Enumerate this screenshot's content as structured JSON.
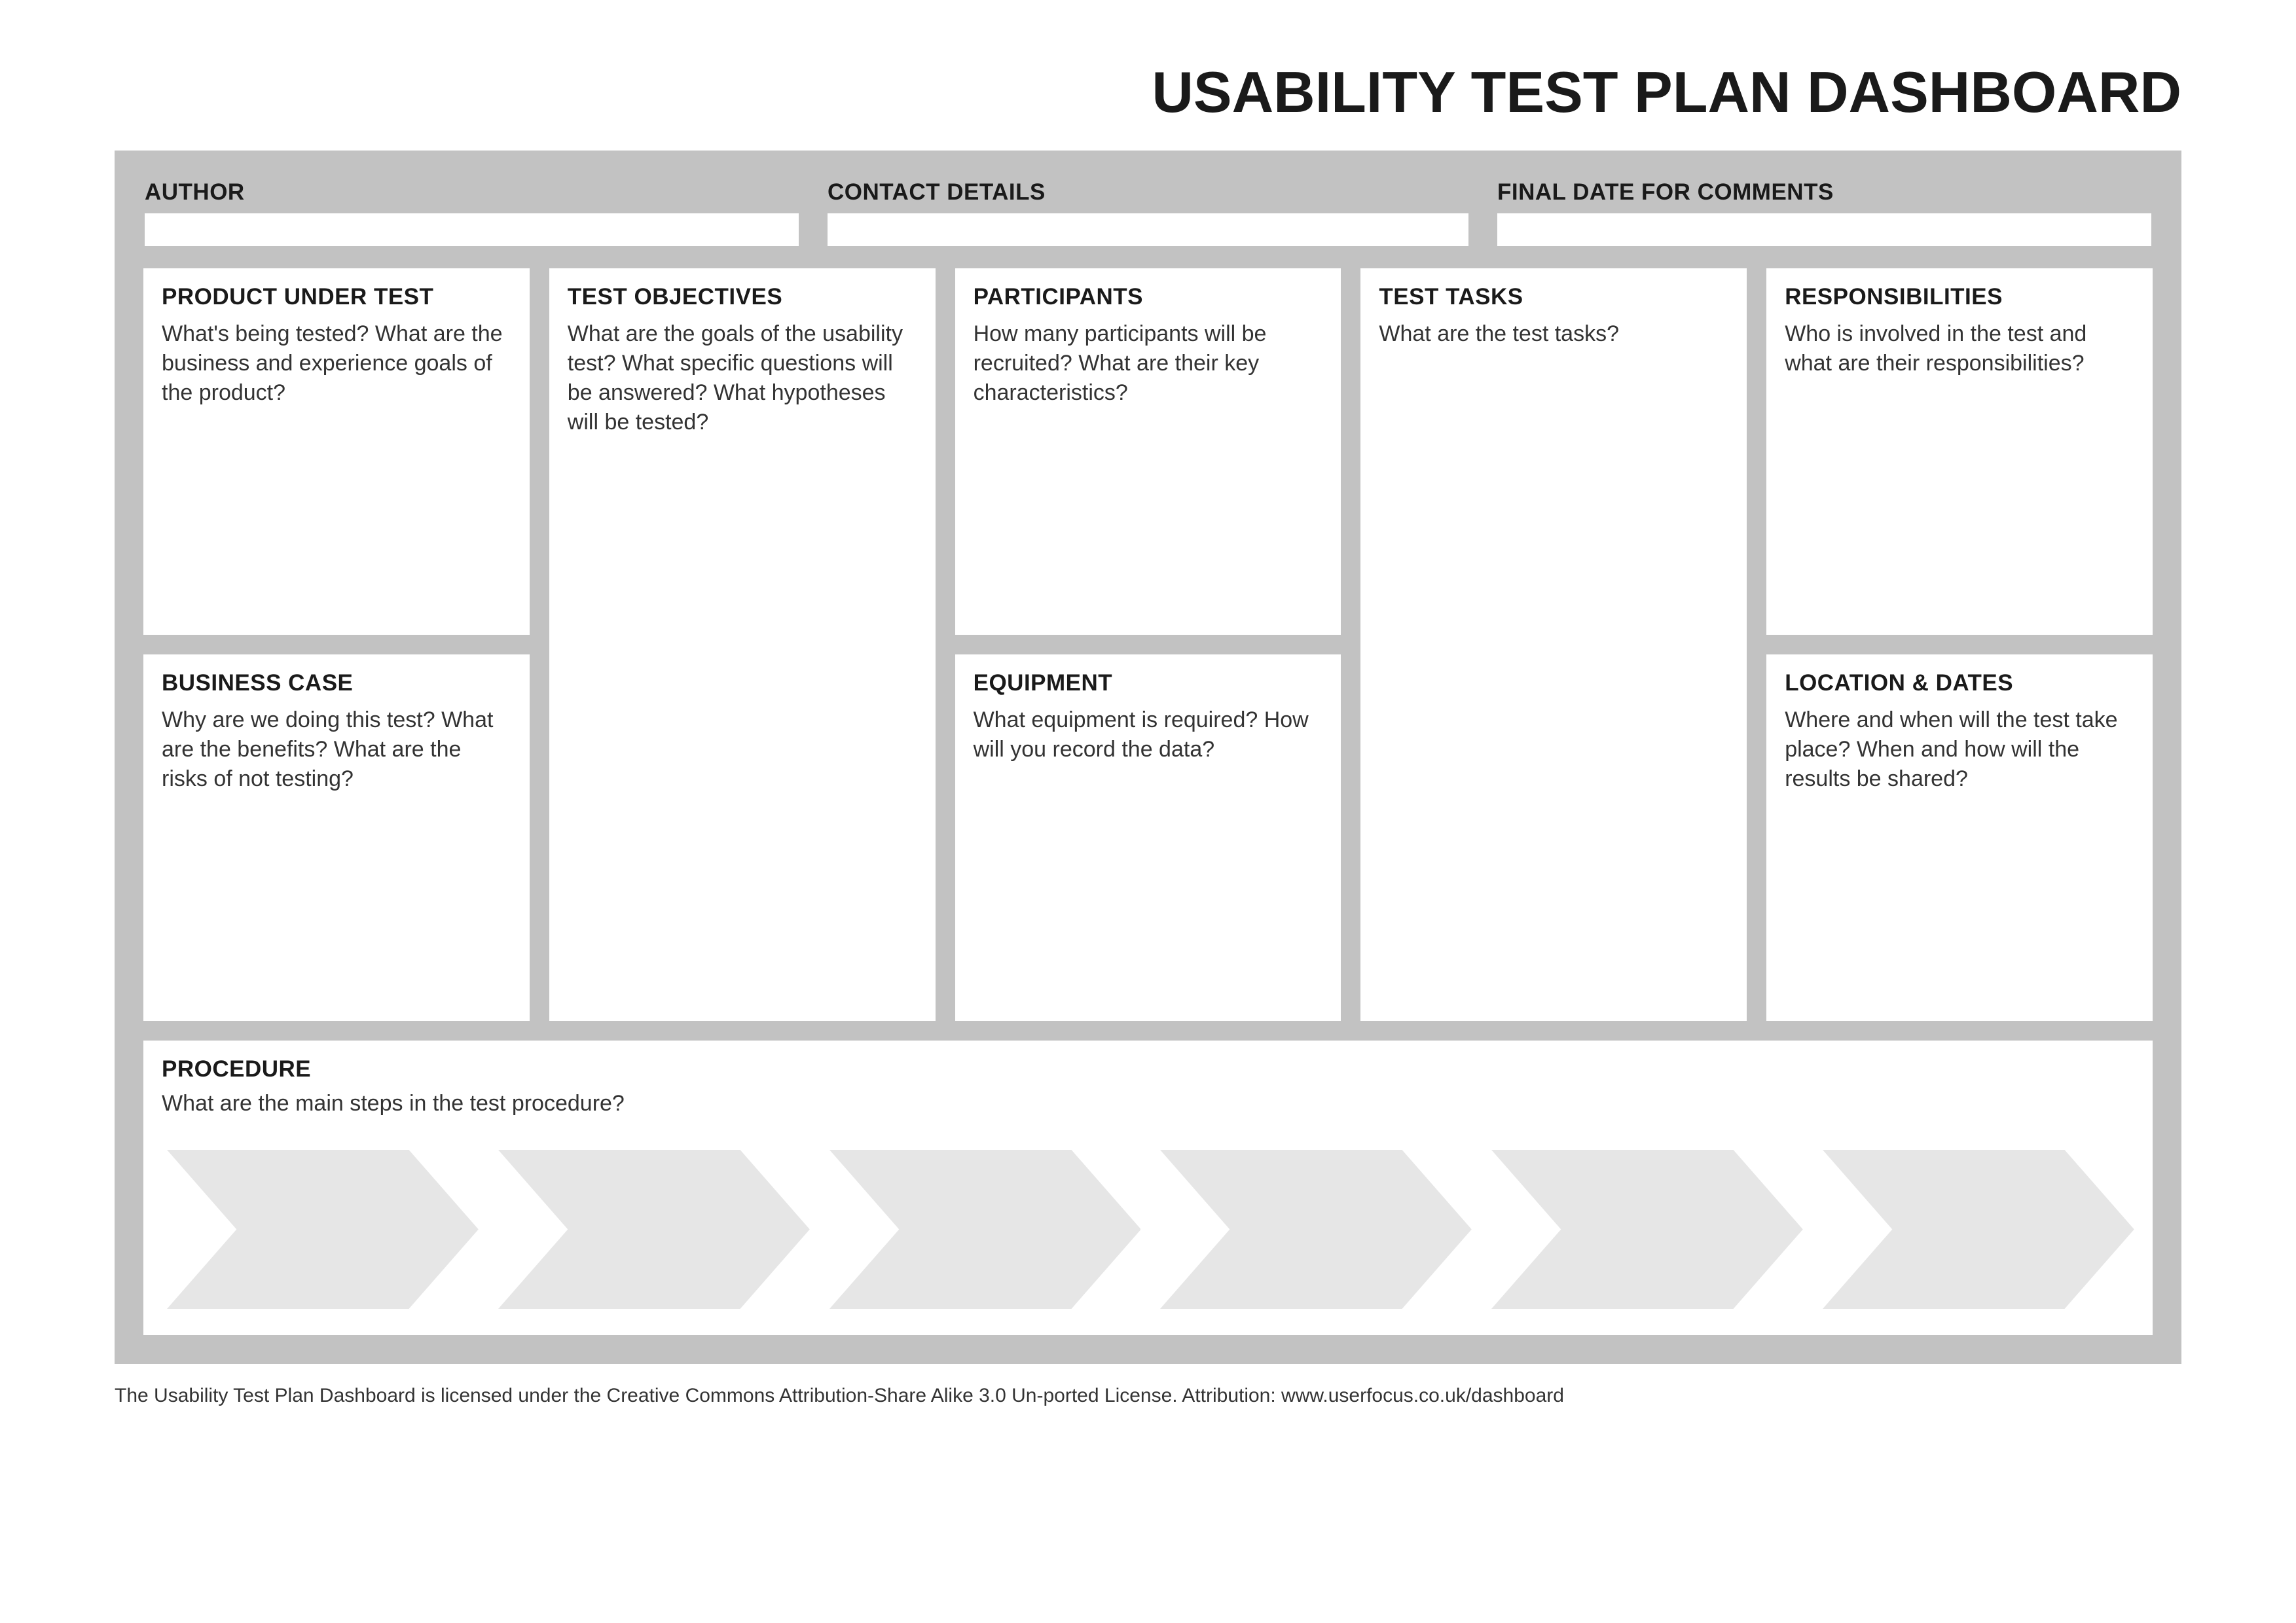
{
  "title": "USABILITY TEST PLAN DASHBOARD",
  "meta": {
    "author_label": "AUTHOR",
    "contact_label": "CONTACT DETAILS",
    "final_date_label": "FINAL DATE FOR COMMENTS",
    "author_value": "",
    "contact_value": "",
    "final_date_value": ""
  },
  "cards": {
    "product_under_test": {
      "title": "PRODUCT UNDER TEST",
      "text": "What's being tested? What are the business and experience goals of the product?"
    },
    "test_objectives": {
      "title": "TEST OBJECTIVES",
      "text": "What are the goals of the usability test? What specific questions will be answered? What hypotheses will be tested?"
    },
    "participants": {
      "title": "PARTICIPANTS",
      "text": "How many participants will be recruited? What are their key characteristics?"
    },
    "test_tasks": {
      "title": "TEST TASKS",
      "text": "What are the test tasks?"
    },
    "responsibilities": {
      "title": "RESPONSIBILITIES",
      "text": "Who is involved in the test and what are their responsibilities?"
    },
    "business_case": {
      "title": "BUSINESS CASE",
      "text": "Why are we doing this test? What are the benefits? What are the risks of not testing?"
    },
    "equipment": {
      "title": "EQUIPMENT",
      "text": "What equipment is required? How will you record the data?"
    },
    "location_dates": {
      "title": "LOCATION & DATES",
      "text": "Where and when will the test take place? When and how will the results be shared?"
    },
    "procedure": {
      "title": "PROCEDURE",
      "text": "What are the main steps in the test procedure?"
    }
  },
  "colors": {
    "canvas_bg": "#c2c2c2",
    "card_bg": "#ffffff",
    "chevron_fill": "#e6e6e6"
  },
  "procedure_steps_count": 6,
  "license": "The Usability Test Plan Dashboard is licensed under the Creative Commons Attribution-Share Alike 3.0 Un-ported License. Attribution: www.userfocus.co.uk/dashboard"
}
